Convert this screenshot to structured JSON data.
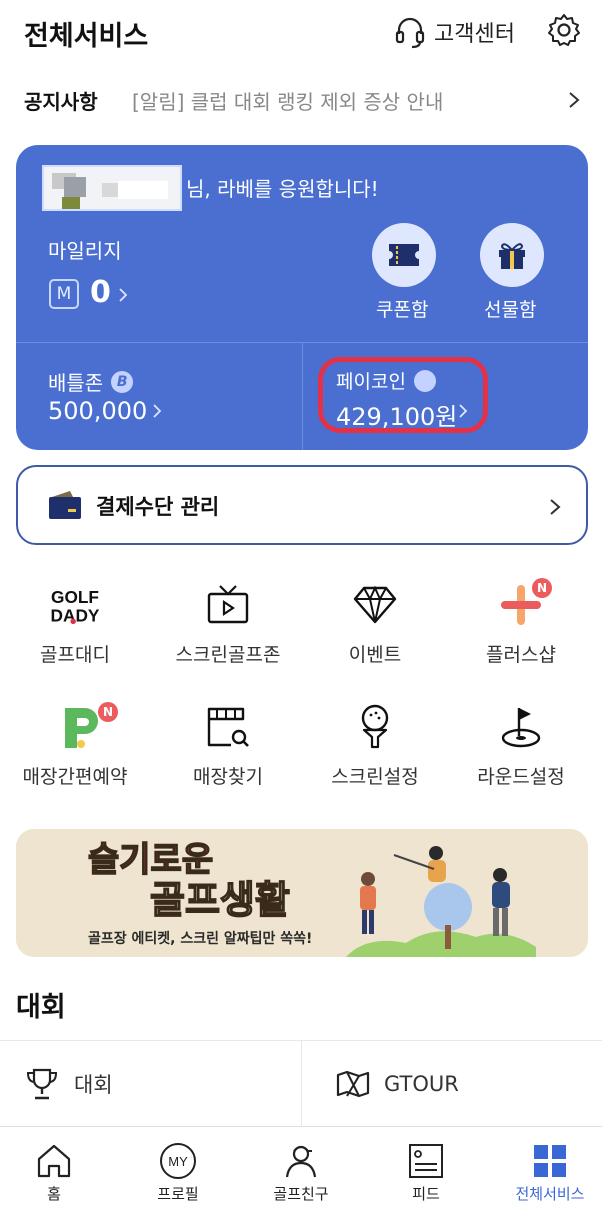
{
  "header": {
    "title": "전체서비스",
    "customer_center": "고객센터",
    "customer_center_icon": "headset-icon",
    "settings_icon": "gear-icon"
  },
  "notice": {
    "label": "공지사항",
    "text": "[알림] 클럽 대회 랭킹 제외 증상 안내"
  },
  "card": {
    "greeting": "님, 라베를 응원합니다!",
    "mileage_label": "마일리지",
    "mileage_badge": "M",
    "mileage_value": "0",
    "coupon_label": "쿠폰함",
    "gift_label": "선물함",
    "battle_label": "배틀존",
    "battle_badge": "B",
    "battle_value": "500,000",
    "paycoin_label": "페이코인",
    "paycoin_value": "429,100원",
    "bg_color": "#4a6fd0",
    "highlight_color": "#e33147"
  },
  "payment": {
    "label": "결제수단 관리"
  },
  "services": [
    {
      "label": "골프대디",
      "icon": "golfdady-logo",
      "logo_text_1": "GOLF",
      "logo_text_2": "DADY"
    },
    {
      "label": "스크린골프존",
      "icon": "tv-play-icon"
    },
    {
      "label": "이벤트",
      "icon": "diamond-icon"
    },
    {
      "label": "플러스샵",
      "icon": "plus-icon",
      "badge": "N"
    },
    {
      "label": "매장간편예약",
      "icon": "p-pin-icon",
      "badge": "N"
    },
    {
      "label": "매장찾기",
      "icon": "store-search-icon"
    },
    {
      "label": "스크린설정",
      "icon": "golf-ball-tee-icon"
    },
    {
      "label": "라운드설정",
      "icon": "golf-flag-icon"
    }
  ],
  "banner": {
    "line1": "슬기로운",
    "line2": "골프생활",
    "subtitle": "골프장 에티켓, 스크린 알짜팁만 쏙쏙!"
  },
  "tournament": {
    "section_title": "대회",
    "item1": "대회",
    "item2": "GTOUR"
  },
  "tabbar": {
    "home": "홈",
    "profile": "프로필",
    "profile_icon_text": "MY",
    "friends": "골프친구",
    "feed": "피드",
    "all": "전체서비스",
    "active_color": "#3a67d6"
  }
}
